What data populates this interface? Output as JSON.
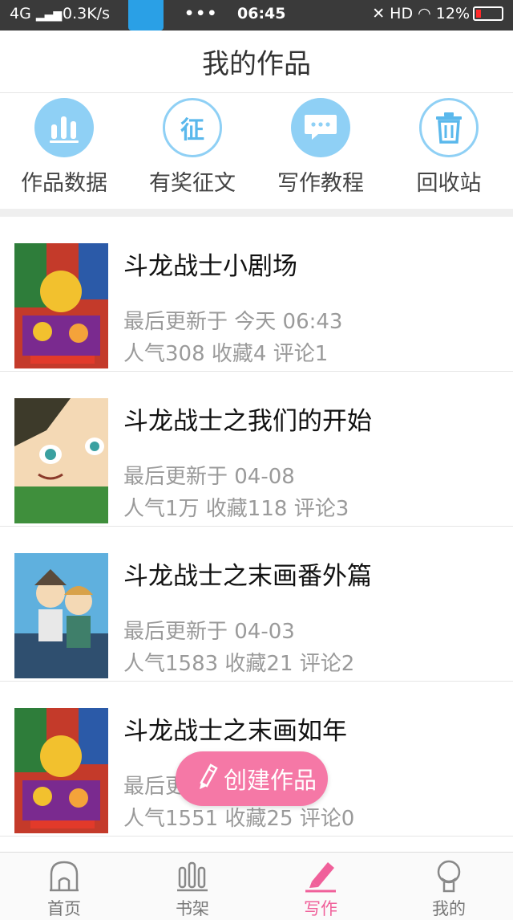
{
  "status_bar": {
    "network": "4G",
    "speed": "0.3K/s",
    "dots": "•••",
    "time": "06:45",
    "hd": "HD",
    "battery": "12%"
  },
  "header": {
    "title": "我的作品"
  },
  "quick_menu": [
    {
      "label": "作品数据",
      "icon": "bar-chart-icon"
    },
    {
      "label": "有奖征文",
      "icon": "zheng-icon",
      "glyph": "征"
    },
    {
      "label": "写作教程",
      "icon": "chat-bubble-icon"
    },
    {
      "label": "回收站",
      "icon": "trash-icon"
    }
  ],
  "works": [
    {
      "title": "斗龙战士小剧场",
      "updated": "最后更新于 今天 06:43",
      "stats": "人气308 收藏4 评论1",
      "cover_colors": [
        "#c43a2a",
        "#2e7d3a",
        "#f2c12e"
      ]
    },
    {
      "title": "斗龙战士之我们的开始",
      "updated": "最后更新于 04-08",
      "stats": "人气1万 收藏118 评论3",
      "cover_colors": [
        "#f4d9b5",
        "#3f8f3c",
        "#222222"
      ]
    },
    {
      "title": "斗龙战士之末画番外篇",
      "updated": "最后更新于 04-03",
      "stats": "人气1583 收藏21 评论2",
      "cover_colors": [
        "#5fb0de",
        "#d8a24a",
        "#2f4f6f"
      ]
    },
    {
      "title": "斗龙战士之末画如年",
      "updated": "最后更新于 04-03",
      "stats": "人气1551 收藏25 评论0",
      "cover_colors": [
        "#c43a2a",
        "#2e7d3a",
        "#f2c12e"
      ]
    }
  ],
  "create_button": {
    "label": "创建作品"
  },
  "tabbar": [
    {
      "label": "首页",
      "icon": "home-icon",
      "active": false
    },
    {
      "label": "书架",
      "icon": "bookshelf-icon",
      "active": false
    },
    {
      "label": "写作",
      "icon": "pencil-icon",
      "active": true
    },
    {
      "label": "我的",
      "icon": "profile-icon",
      "active": false
    }
  ],
  "colors": {
    "accent_blue": "#8fd0f5",
    "accent_pink": "#f578a6",
    "text_muted": "#9a9a9a"
  }
}
